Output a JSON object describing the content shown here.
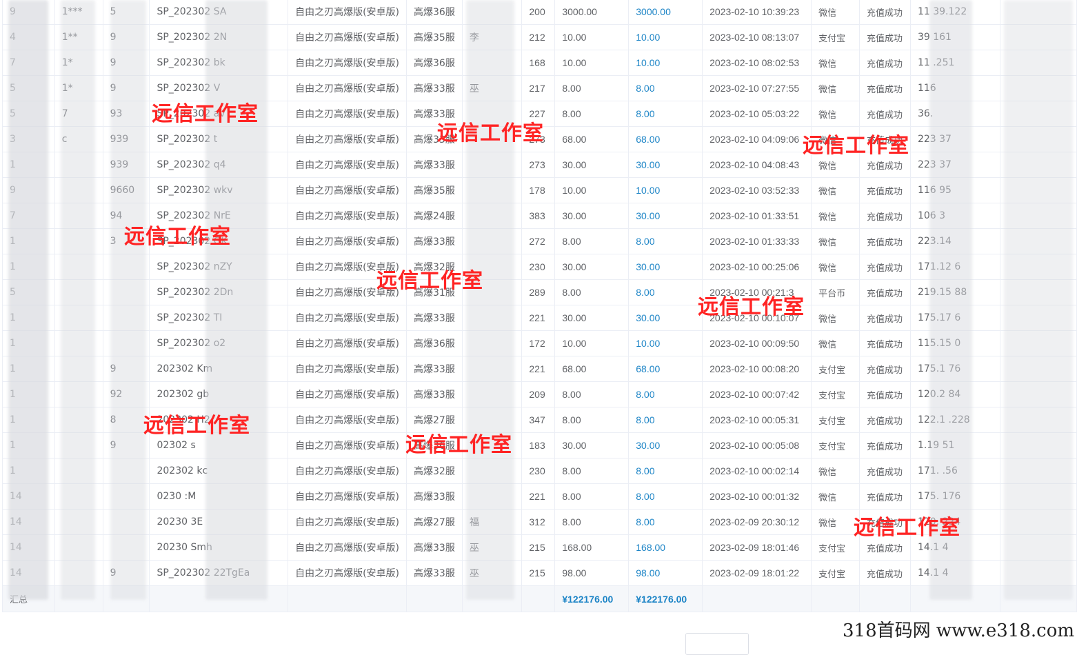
{
  "rows": [
    {
      "c0": "9",
      "c1": "1***",
      "c2": "5",
      "order": "SP_202302 SA",
      "game": "自由之刃高爆版(安卓版)",
      "server": "高爆36服",
      "c6": "",
      "level": "200",
      "amount": "3000.00",
      "paid": "3000.00",
      "time": "2023-02-10 10:39:23",
      "method": "微信",
      "status": "充值成功",
      "ip": "11 39.122"
    },
    {
      "c0": "4",
      "c1": "1**",
      "c2": "9",
      "order": "SP_202302 2N",
      "game": "自由之刃高爆版(安卓版)",
      "server": "高爆35服",
      "c6": "李",
      "level": "212",
      "amount": "10.00",
      "paid": "10.00",
      "time": "2023-02-10 08:13:07",
      "method": "支付宝",
      "status": "充值成功",
      "ip": "39 161"
    },
    {
      "c0": "7",
      "c1": "1*",
      "c2": "9",
      "order": "SP_202302 bk",
      "game": "自由之刃高爆版(安卓版)",
      "server": "高爆36服",
      "c6": "",
      "level": "168",
      "amount": "10.00",
      "paid": "10.00",
      "time": "2023-02-10 08:02:53",
      "method": "微信",
      "status": "充值成功",
      "ip": "11 .251"
    },
    {
      "c0": "5",
      "c1": "1*",
      "c2": "9",
      "order": "SP_202302 V",
      "game": "自由之刃高爆版(安卓版)",
      "server": "高爆33服",
      "c6": "巫",
      "level": "217",
      "amount": "8.00",
      "paid": "8.00",
      "time": "2023-02-10 07:27:55",
      "method": "微信",
      "status": "充值成功",
      "ip": "116"
    },
    {
      "c0": "5",
      "c1": "7",
      "c2": "93",
      "order": "SP_202302 av",
      "game": "自由之刃高爆版(安卓版)",
      "server": "高爆33服",
      "c6": "",
      "level": "227",
      "amount": "8.00",
      "paid": "8.00",
      "time": "2023-02-10 05:03:22",
      "method": "微信",
      "status": "充值成功",
      "ip": "36."
    },
    {
      "c0": "3",
      "c1": "c",
      "c2": "939",
      "order": "SP_202302 t",
      "game": "自由之刃高爆版(安卓版)",
      "server": "高爆33服",
      "c6": "",
      "level": "273",
      "amount": "68.00",
      "paid": "68.00",
      "time": "2023-02-10 04:09:06",
      "method": "微信",
      "status": "充值成功",
      "ip": "223 37"
    },
    {
      "c0": "1",
      "c1": "",
      "c2": "939",
      "order": "SP_202302 q4",
      "game": "自由之刃高爆版(安卓版)",
      "server": "高爆33服",
      "c6": "",
      "level": "273",
      "amount": "30.00",
      "paid": "30.00",
      "time": "2023-02-10 04:08:43",
      "method": "微信",
      "status": "充值成功",
      "ip": "223 37"
    },
    {
      "c0": "9",
      "c1": "",
      "c2": "9660",
      "order": "SP_202302 wkv",
      "game": "自由之刃高爆版(安卓版)",
      "server": "高爆35服",
      "c6": "",
      "level": "178",
      "amount": "10.00",
      "paid": "10.00",
      "time": "2023-02-10 03:52:33",
      "method": "微信",
      "status": "充值成功",
      "ip": "116 95"
    },
    {
      "c0": "7",
      "c1": "",
      "c2": "94",
      "order": "SP_202302 NrE",
      "game": "自由之刃高爆版(安卓版)",
      "server": "高爆24服",
      "c6": "",
      "level": "383",
      "amount": "30.00",
      "paid": "30.00",
      "time": "2023-02-10 01:33:51",
      "method": "微信",
      "status": "充值成功",
      "ip": "106 3"
    },
    {
      "c0": "1",
      "c1": "",
      "c2": "3",
      "order": "SP_202302 GK",
      "game": "自由之刃高爆版(安卓版)",
      "server": "高爆33服",
      "c6": "",
      "level": "272",
      "amount": "8.00",
      "paid": "8.00",
      "time": "2023-02-10 01:33:33",
      "method": "微信",
      "status": "充值成功",
      "ip": "223.14"
    },
    {
      "c0": "1",
      "c1": "",
      "c2": "",
      "order": "SP_202302 nZY",
      "game": "自由之刃高爆版(安卓版)",
      "server": "高爆32服",
      "c6": "",
      "level": "230",
      "amount": "30.00",
      "paid": "30.00",
      "time": "2023-02-10 00:25:06",
      "method": "微信",
      "status": "充值成功",
      "ip": "171.12 6"
    },
    {
      "c0": "5",
      "c1": "",
      "c2": "",
      "order": "SP_202302 2Dn",
      "game": "自由之刃高爆版(安卓版)",
      "server": "高爆31服",
      "c6": "",
      "level": "289",
      "amount": "8.00",
      "paid": "8.00",
      "time": "2023-02-10 00:21:3",
      "method": "平台币",
      "status": "充值成功",
      "ip": "219.15 88"
    },
    {
      "c0": "1",
      "c1": "",
      "c2": "",
      "order": "SP_202302 TI",
      "game": "自由之刃高爆版(安卓版)",
      "server": "高爆33服",
      "c6": "",
      "level": "221",
      "amount": "30.00",
      "paid": "30.00",
      "time": "2023-02-10 00:10:07",
      "method": "微信",
      "status": "充值成功",
      "ip": "175.17 6"
    },
    {
      "c0": "1",
      "c1": "",
      "c2": "",
      "order": "SP_202302 o2",
      "game": "自由之刃高爆版(安卓版)",
      "server": "高爆36服",
      "c6": "",
      "level": "172",
      "amount": "10.00",
      "paid": "10.00",
      "time": "2023-02-10 00:09:50",
      "method": "微信",
      "status": "充值成功",
      "ip": "115.15 0"
    },
    {
      "c0": "1",
      "c1": "",
      "c2": "9",
      "order": "202302 Km",
      "game": "自由之刃高爆版(安卓版)",
      "server": "高爆33服",
      "c6": "",
      "level": "221",
      "amount": "68.00",
      "paid": "68.00",
      "time": "2023-02-10 00:08:20",
      "method": "支付宝",
      "status": "充值成功",
      "ip": "175.1 76"
    },
    {
      "c0": "1",
      "c1": "",
      "c2": "92",
      "order": "202302 gb",
      "game": "自由之刃高爆版(安卓版)",
      "server": "高爆33服",
      "c6": "",
      "level": "209",
      "amount": "8.00",
      "paid": "8.00",
      "time": "2023-02-10 00:07:42",
      "method": "支付宝",
      "status": "充值成功",
      "ip": "120.2 84"
    },
    {
      "c0": "1",
      "c1": "",
      "c2": "8",
      "order": "202302 H2",
      "game": "自由之刃高爆版(安卓版)",
      "server": "高爆27服",
      "c6": "",
      "level": "347",
      "amount": "8.00",
      "paid": "8.00",
      "time": "2023-02-10 00:05:31",
      "method": "支付宝",
      "status": "充值成功",
      "ip": "122.1 .228"
    },
    {
      "c0": "1",
      "c1": "",
      "c2": "9",
      "order": "02302 s",
      "game": "自由之刃高爆版(安卓版)",
      "server": "高爆36服",
      "c6": "",
      "level": "183",
      "amount": "30.00",
      "paid": "30.00",
      "time": "2023-02-10 00:05:08",
      "method": "支付宝",
      "status": "充值成功",
      "ip": "1.19 51"
    },
    {
      "c0": "1",
      "c1": "",
      "c2": "",
      "order": "202302 kc",
      "game": "自由之刃高爆版(安卓版)",
      "server": "高爆32服",
      "c6": "",
      "level": "230",
      "amount": "8.00",
      "paid": "8.00",
      "time": "2023-02-10 00:02:14",
      "method": "微信",
      "status": "充值成功",
      "ip": "171. .56"
    },
    {
      "c0": "14",
      "c1": "",
      "c2": "",
      "order": "0230 :M",
      "game": "自由之刃高爆版(安卓版)",
      "server": "高爆33服",
      "c6": "",
      "level": "221",
      "amount": "8.00",
      "paid": "8.00",
      "time": "2023-02-10 00:01:32",
      "method": "微信",
      "status": "充值成功",
      "ip": "175. 176"
    },
    {
      "c0": "14",
      "c1": "",
      "c2": "",
      "order": "20230 3E",
      "game": "自由之刃高爆版(安卓版)",
      "server": "高爆27服",
      "c6": "福",
      "level": "312",
      "amount": "8.00",
      "paid": "8.00",
      "time": "2023-02-09 20:30:12",
      "method": "微信",
      "status": "充值成功",
      "ip": "120. 224"
    },
    {
      "c0": "14",
      "c1": "",
      "c2": "",
      "order": "20230 Smh",
      "game": "自由之刃高爆版(安卓版)",
      "server": "高爆33服",
      "c6": "巫",
      "level": "215",
      "amount": "168.00",
      "paid": "168.00",
      "time": "2023-02-09 18:01:46",
      "method": "支付宝",
      "status": "充值成功",
      "ip": "14.1 4"
    },
    {
      "c0": "14",
      "c1": "",
      "c2": "9",
      "order": "SP_202302 22TgEa",
      "game": "自由之刃高爆版(安卓版)",
      "server": "高爆33服",
      "c6": "巫",
      "level": "215",
      "amount": "98.00",
      "paid": "98.00",
      "time": "2023-02-09 18:01:22",
      "method": "支付宝",
      "status": "充值成功",
      "ip": "14.1 4"
    }
  ],
  "summary": {
    "label": "汇总",
    "amount_total": "¥122176.00",
    "paid_total": "¥122176.00"
  },
  "watermarks": [
    {
      "text": "远信工作室"
    },
    {
      "text": "远信工作室"
    },
    {
      "text": "远信工作室"
    },
    {
      "text": "远信工作室"
    },
    {
      "text": "远信工作室"
    },
    {
      "text": "远信工作室"
    },
    {
      "text": "远信工作室"
    },
    {
      "text": "远信工作室"
    },
    {
      "text": "远信工作室"
    }
  ],
  "site_watermark": "318首码网  www.e318.com",
  "colors": {
    "paid_text": "#1c84c6",
    "watermark": "#ff2424",
    "border": "#ebeef5"
  }
}
